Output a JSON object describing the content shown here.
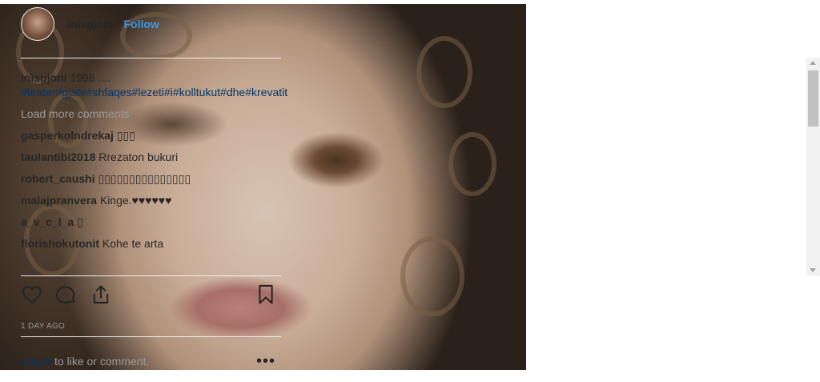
{
  "post": {
    "image_alt": "Close-up portrait with curly hair",
    "author": "inisgjoni",
    "separator": "•",
    "follow_label": "Follow",
    "caption_user": "inisgjoni",
    "caption_text": "1998 ....",
    "caption_tags": "#teater#gjate#shfaqes#lezeti#i#kolltukut#dhe#krevatit",
    "load_more": "Load more comments",
    "comments": [
      {
        "user": "gasperkolndrekaj",
        "text": "▯▯▯"
      },
      {
        "user": "taulantibi2018",
        "text": "Rrezaton bukuri"
      },
      {
        "user": "robert_caushi",
        "text": "▯▯▯▯▯▯▯▯▯▯▯▯▯▯▯"
      },
      {
        "user": "malajpranvera",
        "text": "Kinge.♥♥♥♥♥♥"
      },
      {
        "user": "a_v_c_l_a",
        "text": "▯"
      },
      {
        "user": "florishokutonit",
        "text": "Kohe te arta"
      }
    ],
    "timestamp": "1 DAY AGO",
    "login_link": "Log in",
    "login_rest": " to like or comment.",
    "more_label": "•••"
  },
  "icons": {
    "like": "heart-icon",
    "comment": "comment-icon",
    "share": "share-icon",
    "save": "bookmark-icon",
    "more": "more-options-icon"
  },
  "colors": {
    "link": "#003569",
    "follow": "#3897f0",
    "muted": "#999999"
  }
}
